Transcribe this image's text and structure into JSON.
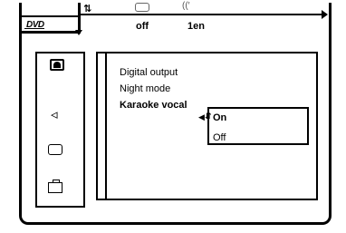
{
  "status_bar": {
    "disc_logo": "DVD",
    "subtitle_value": "off",
    "audio_value": "1en"
  },
  "sidebar": {
    "icons": [
      "video-icon",
      "speaker-icon",
      "speech-bubble-icon",
      "briefcase-icon"
    ]
  },
  "menu": {
    "items": [
      {
        "label": "Digital output"
      },
      {
        "label": "Night mode"
      },
      {
        "label": "Karaoke vocal"
      }
    ]
  },
  "submenu": {
    "options": [
      {
        "label": "On"
      },
      {
        "label": "Off"
      }
    ]
  }
}
